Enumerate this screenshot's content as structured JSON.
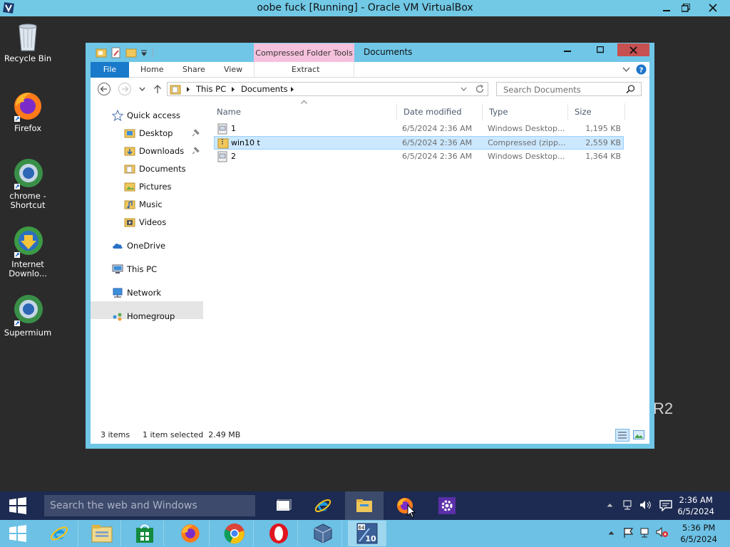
{
  "host": {
    "title": "oobe fuck [Running] - Oracle VM VirtualBox",
    "clock_time": "5:36 PM",
    "clock_date": "6/5/2024"
  },
  "desktop": {
    "icons": [
      {
        "label": "Recycle Bin"
      },
      {
        "label": "Firefox"
      },
      {
        "label": "chrome - Shortcut"
      },
      {
        "label": "Internet Downlo..."
      },
      {
        "label": "Supermium"
      }
    ],
    "watermark": "R2"
  },
  "explorer": {
    "context_tab": "Compressed Folder Tools",
    "window_title": "Documents",
    "ribbon": {
      "file": "File",
      "home": "Home",
      "share": "Share",
      "view": "View",
      "extract": "Extract"
    },
    "breadcrumb": [
      "This PC",
      "Documents"
    ],
    "search_placeholder": "Search Documents",
    "nav": {
      "quick_access": "Quick access",
      "desktop": "Desktop",
      "downloads": "Downloads",
      "documents": "Documents",
      "pictures": "Pictures",
      "music": "Music",
      "videos": "Videos",
      "onedrive": "OneDrive",
      "this_pc": "This PC",
      "network": "Network",
      "homegroup": "Homegroup"
    },
    "columns": {
      "name": "Name",
      "date": "Date modified",
      "type": "Type",
      "size": "Size"
    },
    "files": [
      {
        "name": "1",
        "date": "6/5/2024 2:36 AM",
        "type": "Windows Desktop...",
        "size": "1,195 KB",
        "selected": false
      },
      {
        "name": "win10 t",
        "date": "6/5/2024 2:36 AM",
        "type": "Compressed (zipp...",
        "size": "2,559 KB",
        "selected": true
      },
      {
        "name": "2",
        "date": "6/5/2024 2:36 AM",
        "type": "Windows Desktop...",
        "size": "1,364 KB",
        "selected": false
      }
    ],
    "status": {
      "count": "3 items",
      "selection": "1 item selected  2.49 MB"
    }
  },
  "guest_taskbar": {
    "search_placeholder": "Search the web and Windows",
    "clock_time": "2:36 AM",
    "clock_date": "6/5/2024"
  },
  "colors": {
    "accent": "#1979ca",
    "title_bar": "#6fc6e7",
    "context_tab": "#f6c1dc",
    "selection": "#cce8ff"
  }
}
